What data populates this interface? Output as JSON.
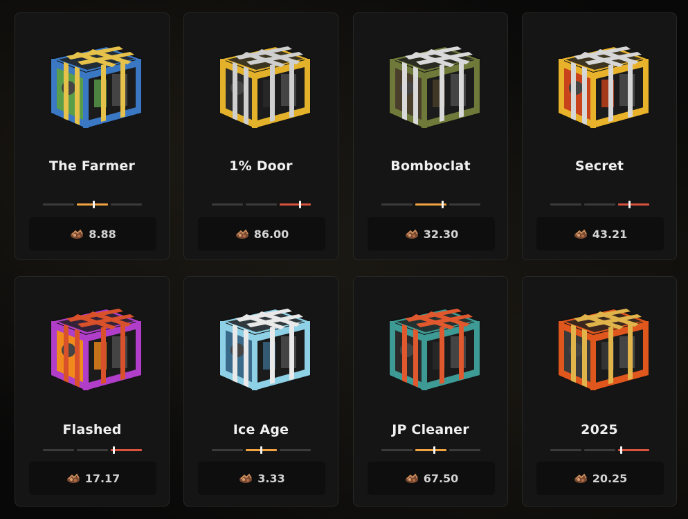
{
  "cases": [
    {
      "name": "The Farmer",
      "price": "8.88",
      "odds_level": 0.51,
      "level_tier": "mid",
      "colors": {
        "frame": "#3a78c4",
        "strap": "#e6c24a",
        "accent": "#5a9e4a"
      }
    },
    {
      "name": "1% Door",
      "price": "86.00",
      "odds_level": 0.88,
      "level_tier": "high",
      "colors": {
        "frame": "#e3b22a",
        "strap": "#cfcfcf",
        "accent": "#2b2b2b"
      }
    },
    {
      "name": "Bomboclat",
      "price": "32.30",
      "odds_level": 0.61,
      "level_tier": "mid",
      "colors": {
        "frame": "#6f7a3a",
        "strap": "#d9d9d9",
        "accent": "#4a3f2a"
      }
    },
    {
      "name": "Secret",
      "price": "43.21",
      "odds_level": 0.79,
      "level_tier": "high",
      "colors": {
        "frame": "#e8b32a",
        "strap": "#d6d6d6",
        "accent": "#c8421c"
      }
    },
    {
      "name": "Flashed",
      "price": "17.17",
      "odds_level": 0.71,
      "level_tier": "high",
      "colors": {
        "frame": "#b03ec8",
        "strap": "#d9512a",
        "accent": "#f08a1c"
      }
    },
    {
      "name": "Ice Age",
      "price": "3.33",
      "odds_level": 0.49,
      "level_tier": "mid",
      "colors": {
        "frame": "#8ed0e6",
        "strap": "#e9e9e9",
        "accent": "#3a6a8a"
      }
    },
    {
      "name": "JP Cleaner",
      "price": "67.50",
      "odds_level": 0.53,
      "level_tier": "mid",
      "colors": {
        "frame": "#3e9a94",
        "strap": "#e0582e",
        "accent": "#2a2a2a"
      }
    },
    {
      "name": "2025",
      "price": "20.25",
      "odds_level": 0.71,
      "level_tier": "high",
      "colors": {
        "frame": "#e0571e",
        "strap": "#e0b44a",
        "accent": "#3a3a3a"
      }
    }
  ],
  "currency_icon": "scrap-coin-icon",
  "tier_colors": {
    "mid": "#f2a341",
    "high": "#d9533e"
  }
}
